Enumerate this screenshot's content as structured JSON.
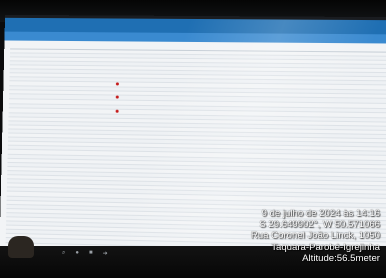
{
  "app": {
    "title": "",
    "toolbar_label": "",
    "toolbar_link": ""
  },
  "table": {
    "headers": [
      "",
      "",
      "",
      "",
      "",
      "",
      "",
      "",
      "",
      "",
      "",
      ""
    ],
    "rows": []
  },
  "taskbar": {
    "icons": [
      "search-icon",
      "record-icon",
      "square-icon",
      "arrow-icon"
    ],
    "glyphs": [
      "⌕",
      "●",
      "■",
      "➜"
    ]
  },
  "geotag": {
    "date_time": "9 de julho de 2024 às 14:16",
    "coordinates": "S 29.649902°, W 50.571066",
    "street": "Rua Coronel João Linck, 1050",
    "locality": "Taquara-Parobé-Igrejinha",
    "altitude": "Altitude:56.5meter"
  }
}
